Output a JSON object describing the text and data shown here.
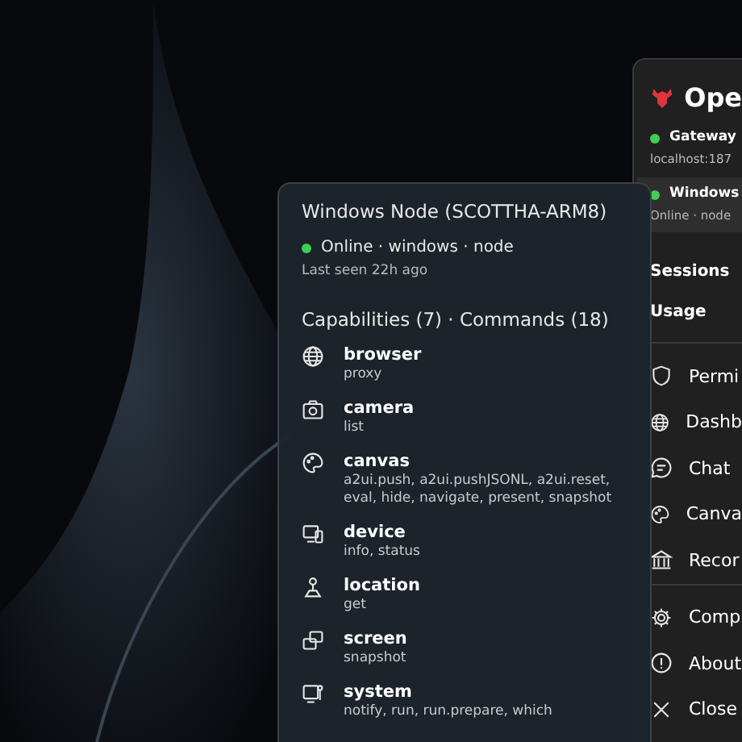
{
  "main_panel": {
    "title": "Ope",
    "gateway": {
      "label": "Gateway",
      "address": "localhost:187",
      "online": true
    },
    "node": {
      "label": "Windows",
      "status": "Online · node",
      "online": true,
      "selected": true
    },
    "sections": [
      "Sessions",
      "Usage"
    ],
    "menu": [
      {
        "kind": "shield",
        "label": "Permi"
      },
      {
        "kind": "globe",
        "label": "Dashb"
      },
      {
        "kind": "chat",
        "label": "Chat"
      },
      {
        "kind": "palette",
        "label": "Canva"
      },
      {
        "kind": "bank",
        "label": "Recor"
      }
    ],
    "footer": [
      {
        "kind": "gear",
        "label": "Comp"
      },
      {
        "kind": "info",
        "label": "About"
      },
      {
        "kind": "close",
        "label": "Close"
      }
    ]
  },
  "node_flyout": {
    "title": "Windows Node (SCOTTHA-ARM8)",
    "online": true,
    "status": "Online · windows · node",
    "last_seen": "Last seen 22h ago",
    "heading": "Capabilities (7) · Commands (18)",
    "capabilities": [
      {
        "kind": "globe",
        "name": "browser",
        "commands": "proxy"
      },
      {
        "kind": "camera",
        "name": "camera",
        "commands": "list"
      },
      {
        "kind": "palette",
        "name": "canvas",
        "commands": "a2ui.push, a2ui.pushJSONL, a2ui.reset, eval, hide, navigate, present, snapshot"
      },
      {
        "kind": "device",
        "name": "device",
        "commands": "info, status"
      },
      {
        "kind": "pin",
        "name": "location",
        "commands": "get"
      },
      {
        "kind": "screens",
        "name": "screen",
        "commands": "snapshot"
      },
      {
        "kind": "system",
        "name": "system",
        "commands": "notify, run, run.prepare, which"
      }
    ]
  }
}
